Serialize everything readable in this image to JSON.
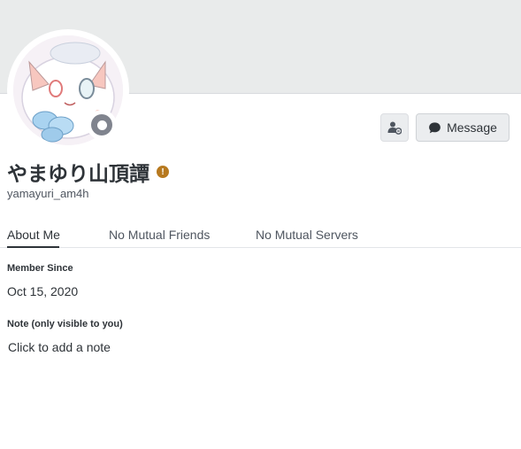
{
  "profile": {
    "display_name": "やまゆり山頂譚",
    "username": "yamayuri_am4h",
    "status": "offline",
    "badge_icon": "warning-badge-icon"
  },
  "actions": {
    "add_friend_icon": "add-friend-icon",
    "message_label": "Message",
    "message_icon": "chat-bubble-icon"
  },
  "tabs": [
    {
      "label": "About Me",
      "active": true
    },
    {
      "label": "No Mutual Friends",
      "active": false
    },
    {
      "label": "No Mutual Servers",
      "active": false
    }
  ],
  "about": {
    "member_since_title": "Member Since",
    "member_since_value": "Oct 15, 2020",
    "note_title": "Note (only visible to you)",
    "note_placeholder": "Click to add a note"
  },
  "colors": {
    "banner": "#e9ebeb",
    "status_offline": "#80848e",
    "badge": "#b7791f"
  }
}
